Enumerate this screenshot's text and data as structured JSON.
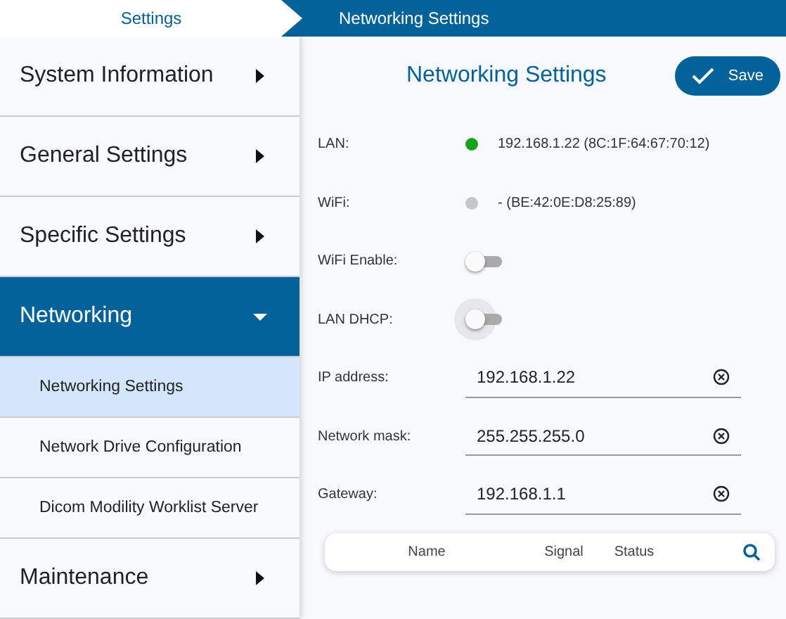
{
  "breadcrumb": [
    {
      "label": "Settings",
      "selected": false
    },
    {
      "label": "Networking Settings",
      "selected": true
    }
  ],
  "sidebar": {
    "items": [
      {
        "label": "System Information",
        "expanded": false
      },
      {
        "label": "General Settings",
        "expanded": false
      },
      {
        "label": "Specific Settings",
        "expanded": false
      },
      {
        "label": "Networking",
        "expanded": true,
        "children": [
          {
            "label": "Networking Settings",
            "selected": true
          },
          {
            "label": "Network Drive Configuration",
            "selected": false
          },
          {
            "label": "Dicom Modility Worklist Server",
            "selected": false
          }
        ]
      },
      {
        "label": "Maintenance",
        "expanded": false
      }
    ]
  },
  "title": "Networking Settings",
  "save_button": "Save",
  "rows": [
    {
      "kind": "status",
      "label": "LAN:",
      "color": "#1aa31a",
      "value": "192.168.1.22 (8C:1F:64:67:70:12)"
    },
    {
      "kind": "status",
      "label": "WiFi:",
      "color": "#c4c6cc",
      "value": "- (BE:42:0E:D8:25:89)"
    },
    {
      "kind": "toggle",
      "label": "WiFi Enable:",
      "on": false,
      "focused": false
    },
    {
      "kind": "toggle",
      "label": "LAN DHCP:",
      "on": false,
      "focused": true
    },
    {
      "kind": "field",
      "label": "IP address:",
      "value": "192.168.1.22"
    },
    {
      "kind": "field",
      "label": "Network mask:",
      "value": "255.255.255.0"
    },
    {
      "kind": "field",
      "label": "Gateway:",
      "value": "192.168.1.1"
    }
  ],
  "table": {
    "columns": [
      "Name",
      "Signal",
      "Status"
    ]
  }
}
